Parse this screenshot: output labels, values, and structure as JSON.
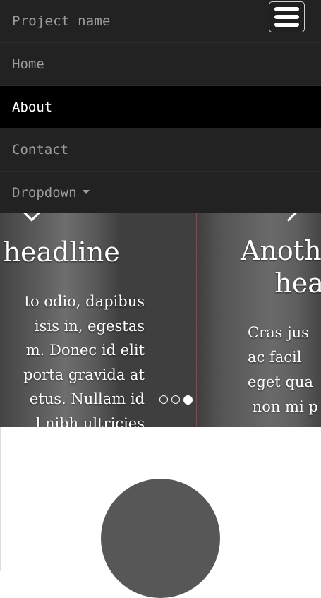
{
  "navbar": {
    "brand": "Project name",
    "items": [
      {
        "label": "Home",
        "active": false
      },
      {
        "label": "About",
        "active": true
      },
      {
        "label": "Contact",
        "active": false
      },
      {
        "label": "Dropdown",
        "active": false,
        "has_caret": true
      }
    ]
  },
  "carousel": {
    "slides": [
      {
        "headline": "e headline",
        "body": "to odio, dapibus\nisis in, egestas\nm. Donec id elit\nporta gravida at\netus. Nullam id\nl nibh ultricies"
      },
      {
        "headline": "Anoth\n    hea",
        "body": "Cras jus\nac facil\neget qua\n non mi p"
      }
    ],
    "indicator_count": 3,
    "active_indicator": 2
  },
  "colors": {
    "navbar_bg": "#222222",
    "active_bg": "#000000",
    "nav_text": "#9d9d9d",
    "active_text": "#ffffff",
    "featurette_circle": "#575757"
  },
  "icons": {
    "toggle": "hamburger-menu-icon",
    "dropdown": "caret-down-icon",
    "prev": "chevron-left-icon",
    "next": "chevron-right-icon"
  }
}
